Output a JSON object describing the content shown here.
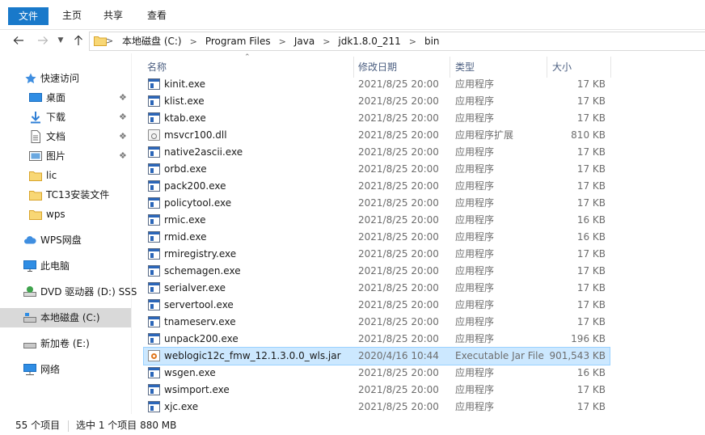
{
  "ribbon": {
    "tabs": [
      "文件",
      "主页",
      "共享",
      "查看"
    ]
  },
  "nav": {
    "back_icon": "arrow-left-icon",
    "forward_icon": "arrow-right-icon",
    "up_icon": "arrow-up-icon",
    "breadcrumbs": [
      "本地磁盘 (C:)",
      "Program Files",
      "Java",
      "jdk1.8.0_211",
      "bin"
    ]
  },
  "sidebar": {
    "quick_access": "快速访问",
    "pinned": [
      {
        "label": "桌面",
        "icon": "desktop-icon"
      },
      {
        "label": "下载",
        "icon": "download-icon"
      },
      {
        "label": "文档",
        "icon": "document-icon"
      },
      {
        "label": "图片",
        "icon": "picture-icon"
      }
    ],
    "folders": [
      "lic",
      "TC13安装文件",
      "wps"
    ],
    "wps_drive": "WPS网盘",
    "this_pc": "此电脑",
    "dvd": "DVD 驱动器 (D:) SSS",
    "local_disk": "本地磁盘 (C:)",
    "new_volume": "新加卷 (E:)",
    "network": "网络"
  },
  "columns": {
    "name": "名称",
    "date": "修改日期",
    "type": "类型",
    "size": "大小"
  },
  "files": [
    {
      "name": "kinit.exe",
      "date": "2021/8/25 20:00",
      "type": "应用程序",
      "size": "17 KB",
      "kind": "exe"
    },
    {
      "name": "klist.exe",
      "date": "2021/8/25 20:00",
      "type": "应用程序",
      "size": "17 KB",
      "kind": "exe"
    },
    {
      "name": "ktab.exe",
      "date": "2021/8/25 20:00",
      "type": "应用程序",
      "size": "17 KB",
      "kind": "exe"
    },
    {
      "name": "msvcr100.dll",
      "date": "2021/8/25 20:00",
      "type": "应用程序扩展",
      "size": "810 KB",
      "kind": "dll"
    },
    {
      "name": "native2ascii.exe",
      "date": "2021/8/25 20:00",
      "type": "应用程序",
      "size": "17 KB",
      "kind": "exe"
    },
    {
      "name": "orbd.exe",
      "date": "2021/8/25 20:00",
      "type": "应用程序",
      "size": "17 KB",
      "kind": "exe"
    },
    {
      "name": "pack200.exe",
      "date": "2021/8/25 20:00",
      "type": "应用程序",
      "size": "17 KB",
      "kind": "exe"
    },
    {
      "name": "policytool.exe",
      "date": "2021/8/25 20:00",
      "type": "应用程序",
      "size": "17 KB",
      "kind": "exe"
    },
    {
      "name": "rmic.exe",
      "date": "2021/8/25 20:00",
      "type": "应用程序",
      "size": "16 KB",
      "kind": "exe"
    },
    {
      "name": "rmid.exe",
      "date": "2021/8/25 20:00",
      "type": "应用程序",
      "size": "16 KB",
      "kind": "exe"
    },
    {
      "name": "rmiregistry.exe",
      "date": "2021/8/25 20:00",
      "type": "应用程序",
      "size": "17 KB",
      "kind": "exe"
    },
    {
      "name": "schemagen.exe",
      "date": "2021/8/25 20:00",
      "type": "应用程序",
      "size": "17 KB",
      "kind": "exe"
    },
    {
      "name": "serialver.exe",
      "date": "2021/8/25 20:00",
      "type": "应用程序",
      "size": "17 KB",
      "kind": "exe"
    },
    {
      "name": "servertool.exe",
      "date": "2021/8/25 20:00",
      "type": "应用程序",
      "size": "17 KB",
      "kind": "exe"
    },
    {
      "name": "tnameserv.exe",
      "date": "2021/8/25 20:00",
      "type": "应用程序",
      "size": "17 KB",
      "kind": "exe"
    },
    {
      "name": "unpack200.exe",
      "date": "2021/8/25 20:00",
      "type": "应用程序",
      "size": "196 KB",
      "kind": "exe"
    },
    {
      "name": "weblogic12c_fmw_12.1.3.0.0_wls.jar",
      "date": "2020/4/16 10:44",
      "type": "Executable Jar File",
      "size": "901,543 KB",
      "kind": "jar",
      "selected": true
    },
    {
      "name": "wsgen.exe",
      "date": "2021/8/25 20:00",
      "type": "应用程序",
      "size": "16 KB",
      "kind": "exe"
    },
    {
      "name": "wsimport.exe",
      "date": "2021/8/25 20:00",
      "type": "应用程序",
      "size": "17 KB",
      "kind": "exe"
    },
    {
      "name": "xjc.exe",
      "date": "2021/8/25 20:00",
      "type": "应用程序",
      "size": "17 KB",
      "kind": "exe"
    }
  ],
  "status": {
    "count": "55 个项目",
    "selection": "选中 1 个项目  880 MB"
  }
}
